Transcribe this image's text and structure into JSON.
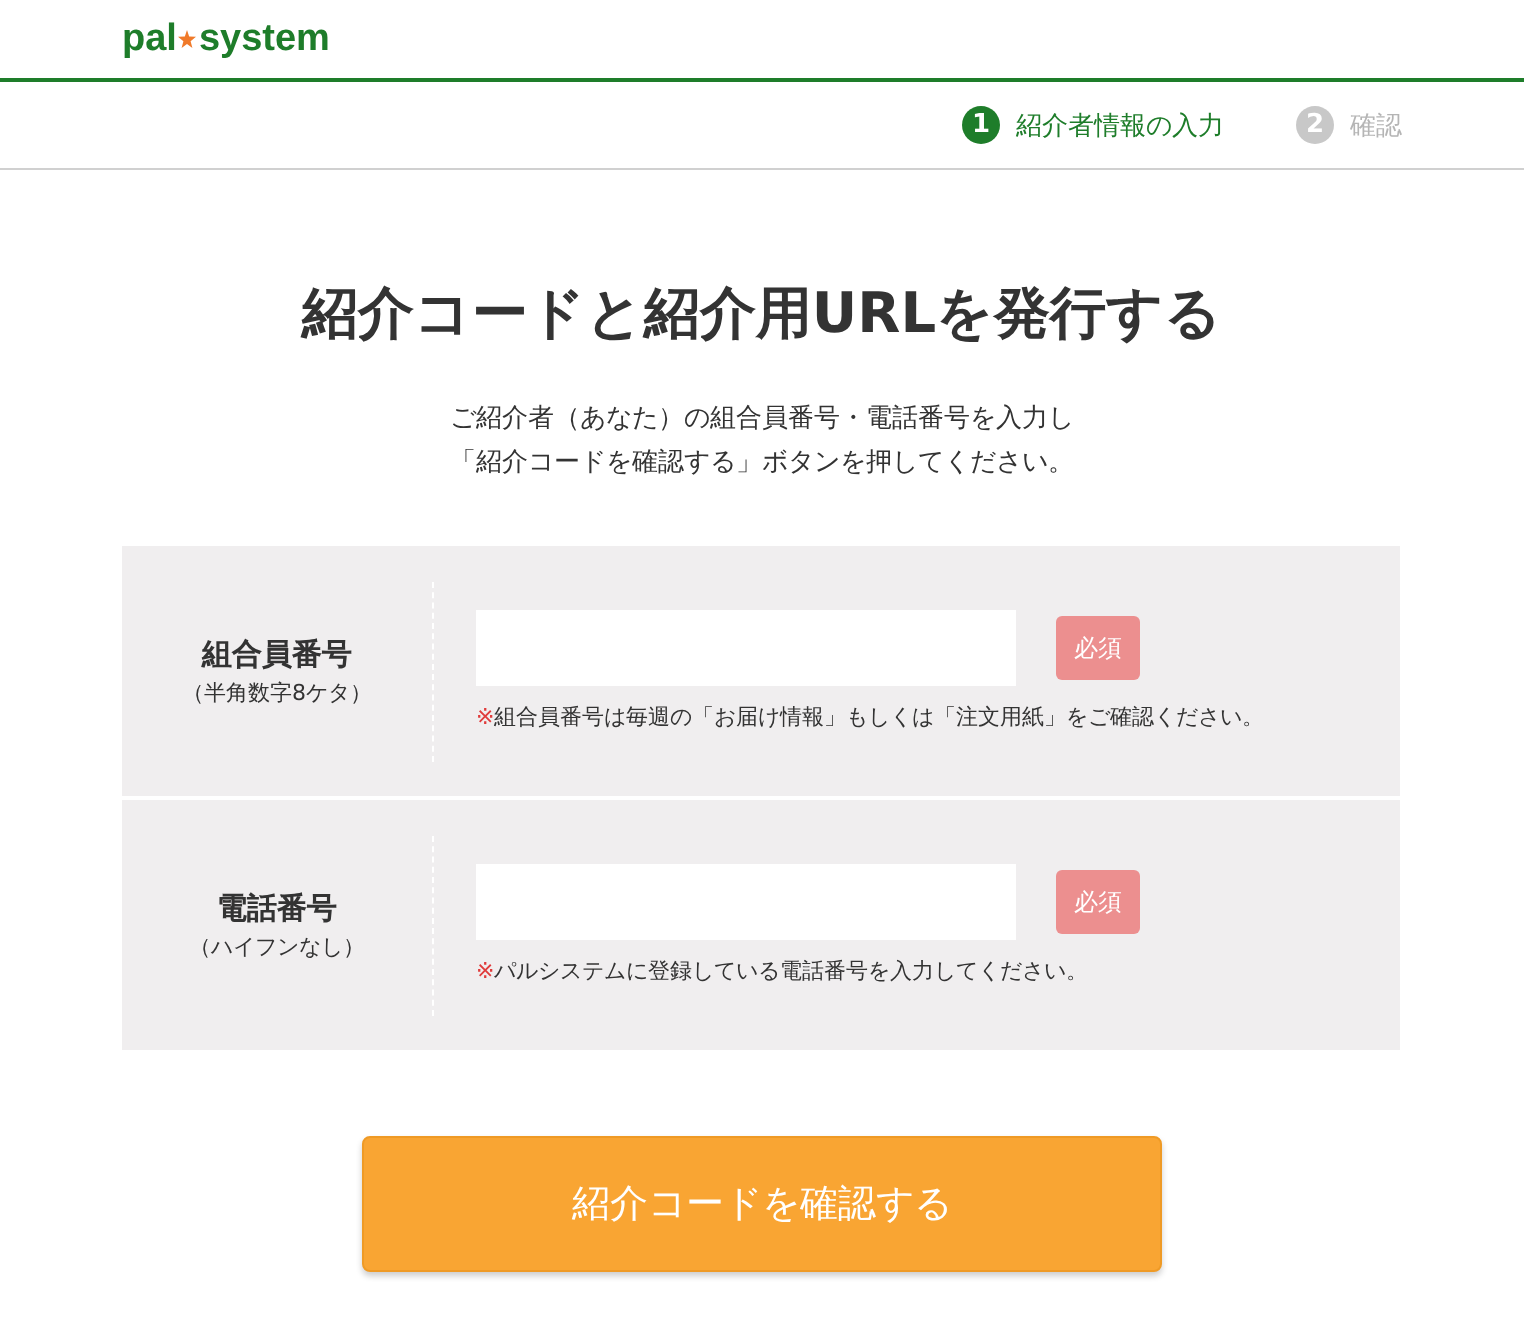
{
  "logo": {
    "left": "pal",
    "right": "system"
  },
  "steps": [
    {
      "number": "1",
      "label": "紹介者情報の入力",
      "selected": true
    },
    {
      "number": "2",
      "label": "確認",
      "selected": false
    }
  ],
  "title": "紹介コードと紹介用URLを発行する",
  "description": [
    "ご紹介者（あなた）の組合員番号・電話番号を入力し",
    "「紹介コードを確認する」ボタンを押してください。"
  ],
  "fields": [
    {
      "label": "組合員番号",
      "sublabel": "（半角数字8ケタ）",
      "required": "必須",
      "note_mark": "※",
      "note": "組合員番号は毎週の「お届け情報」もしくは「注文用紙」をご確認ください。"
    },
    {
      "label": "電話番号",
      "sublabel": "（ハイフンなし）",
      "required": "必須",
      "note_mark": "※",
      "note": "パルシステムに登録している電話番号を入力してください。"
    }
  ],
  "submit_button": "紹介コードを確認する"
}
